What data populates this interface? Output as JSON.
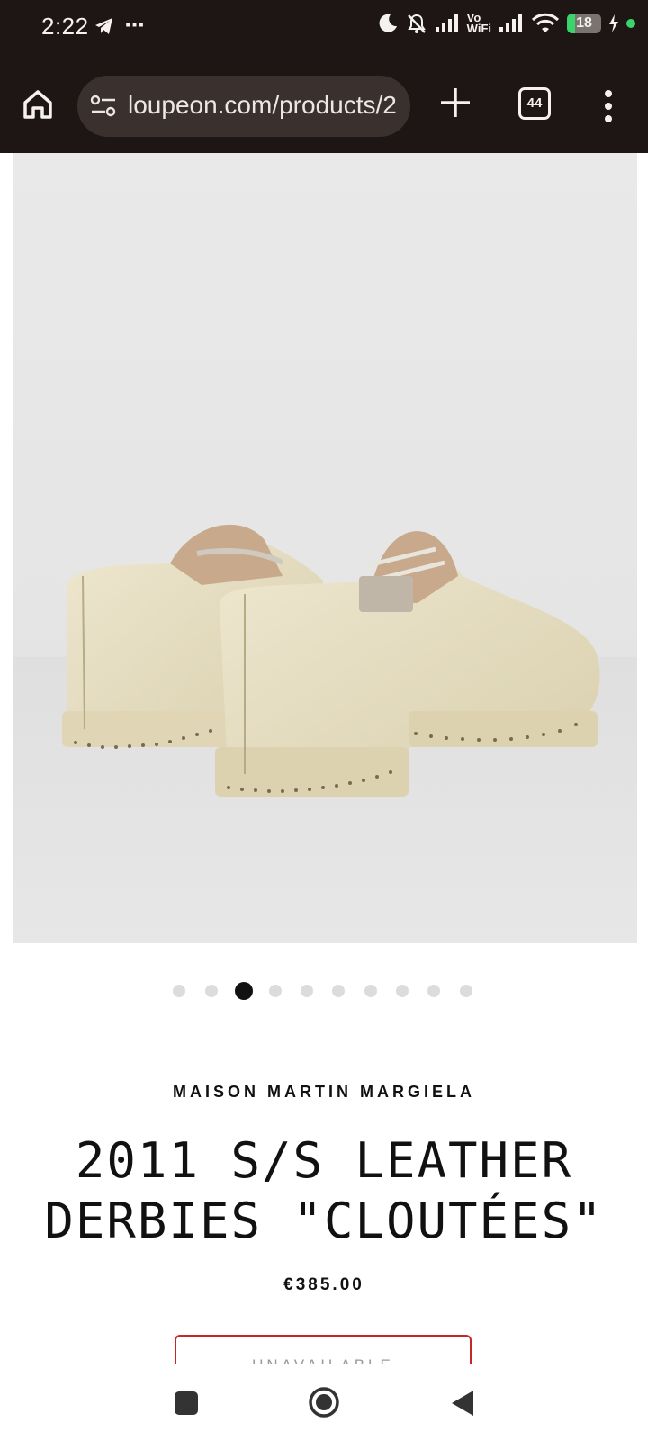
{
  "status_bar": {
    "time": "2:22",
    "more_indicator": "···",
    "vowifi_top": "Vo",
    "vowifi_bottom": "WiFi",
    "battery_level": "18",
    "icons": [
      "telegram-icon",
      "do-not-disturb-icon",
      "bell-off-icon",
      "signal-icon",
      "wifi-icon",
      "battery-icon",
      "charging-icon"
    ]
  },
  "browser": {
    "url": "loupeon.com/products/2",
    "tab_count": "44",
    "icons": [
      "home-icon",
      "site-settings-icon",
      "plus-icon",
      "tabs-icon",
      "more-vert-icon"
    ]
  },
  "product": {
    "image_alt": "Pair of off-white leather derby shoes with studded soles",
    "carousel": {
      "total": 10,
      "active_index": 2
    },
    "brand": "MAISON MARTIN MARGIELA",
    "title_line1": "2011 S/S LEATHER",
    "title_line2": "DERBIES \"CLOUTÉES\"",
    "price": "€385.00",
    "button_label": "UNAVAILABLE"
  },
  "navbar": {
    "icons": [
      "recents-icon",
      "home-circle-icon",
      "back-icon"
    ]
  },
  "colors": {
    "chrome_bg": "#1e1614",
    "url_pill_bg": "#3a312e",
    "battery_green": "#3bd36c",
    "button_border": "#c62828",
    "text_dark": "#111111"
  }
}
